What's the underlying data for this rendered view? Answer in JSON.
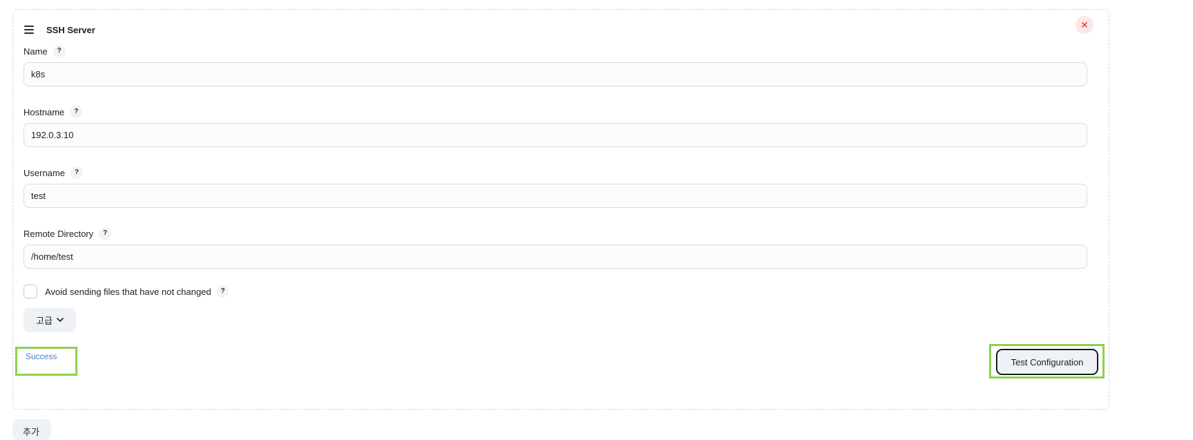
{
  "panel": {
    "title": "SSH Server",
    "close_symbol": "✕"
  },
  "fields": {
    "name": {
      "label": "Name",
      "value": "k8s"
    },
    "hostname": {
      "label": "Hostname",
      "value": "192.0.3.10"
    },
    "username": {
      "label": "Username",
      "value": "test"
    },
    "remote_directory": {
      "label": "Remote Directory",
      "value": "/home/test"
    }
  },
  "help_symbol": "?",
  "checkbox": {
    "label": "Avoid sending files that have not changed",
    "checked": false
  },
  "advanced": {
    "label": "고급",
    "chevron": "⌄"
  },
  "status": {
    "text": "Success",
    "color": "#4c78c7"
  },
  "test_button": {
    "label": "Test Configuration"
  },
  "add_button": {
    "label": "추가"
  },
  "highlight_color": "#8dd14f",
  "icons": {
    "drag_handle": "hamburger-icon",
    "close": "close-icon",
    "help": "help-icon",
    "chevron": "chevron-down-icon"
  }
}
